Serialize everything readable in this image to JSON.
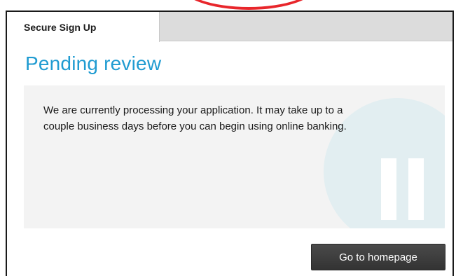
{
  "tab": {
    "label": "Secure Sign Up"
  },
  "page": {
    "title": "Pending review"
  },
  "message": {
    "text": "We are currently processing your application. It may take up to a couple business days before you can begin using online banking."
  },
  "status_icon": {
    "name": "pause-icon"
  },
  "actions": {
    "home_label": "Go to homepage"
  },
  "colors": {
    "title": "#1f9bd1",
    "panel": "#f3f3f3",
    "badge": "#e2eef1",
    "button": "#3c3c3c",
    "annotation": "#e8262b"
  }
}
